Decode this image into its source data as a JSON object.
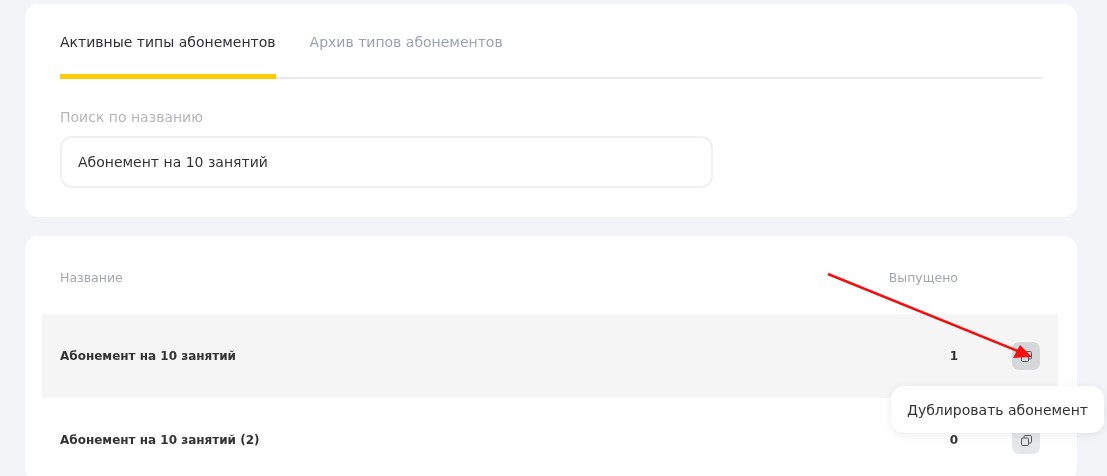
{
  "tabs": [
    {
      "label": "Активные типы абонементов",
      "selected": true
    },
    {
      "label": "Архив типов абонементов",
      "selected": false
    }
  ],
  "search": {
    "label": "Поиск по названию",
    "value": "Абонемент на 10 занятий"
  },
  "table": {
    "columns": [
      "Название",
      "Выпущено"
    ],
    "rows": [
      {
        "name": "Абонемент на 10 занятий",
        "issued": "1",
        "highlighted": true
      },
      {
        "name": "Абонемент на 10 занятий (2)",
        "issued": "0",
        "highlighted": false
      }
    ]
  },
  "tooltip": "Дублировать абонемент"
}
